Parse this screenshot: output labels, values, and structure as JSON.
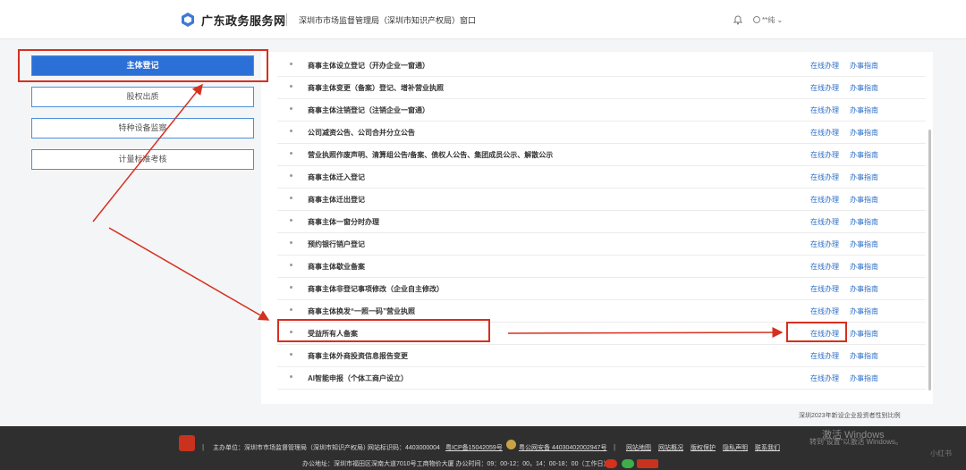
{
  "header": {
    "site_title": "广东政务服务网",
    "department": "深圳市市场监督管理局（深圳市知识产权局）窗口",
    "user_name": "**纯"
  },
  "left_nav": {
    "items": [
      {
        "label": "主体登记",
        "active": true
      },
      {
        "label": "股权出质",
        "active": false
      },
      {
        "label": "特种设备监察",
        "active": false
      },
      {
        "label": "计量标准考核",
        "active": false
      }
    ]
  },
  "service_list": {
    "online_label": "在线办理",
    "guide_label": "办事指南",
    "items": [
      "商事主体设立登记（开办企业一窗通）",
      "商事主体变更（备案）登记、增补营业执照",
      "商事主体注销登记（注销企业一窗通）",
      "公司减资公告、公司合并分立公告",
      "营业执照作废声明、清算组公告/备案、债权人公告、集团成员公示、解散公示",
      "商事主体迁入登记",
      "商事主体迁出登记",
      "商事主体一窗分时办理",
      "预约银行销户登记",
      "商事主体歇业备案",
      "商事主体非登记事项修改（企业自主修改）",
      "商事主体换发“一照一码”营业执照",
      "受益所有人备案",
      "商事主体外商投资信息报告变更",
      "AI智能申报（个体工商户设立）"
    ]
  },
  "caption": "深圳2023年新设企业投资者性别比例",
  "footer": {
    "sponsor": "主办单位：深圳市市场监督管理局（深圳市知识产权局）",
    "site_code": "网站标识码：4403000004",
    "icp": "粤ICP备15042059号",
    "police": "粤公网安备 44030402002947号",
    "links": [
      "网站地图",
      "网站概况",
      "版权保护",
      "隐私声明",
      "联系我们"
    ],
    "address": "办公地址：深圳市福田区深南大道7010号工商物价大厦  办公时间：09：00-12：00，14：00-18：00（工作日）"
  },
  "os_overlay": {
    "activate_title": "激活 Windows",
    "activate_hint": "转到“设置”以激活 Windows。",
    "watermark": "小红书"
  },
  "colors": {
    "accent_blue": "#2b70d6",
    "link_blue": "#2b6ec9",
    "highlight_red": "#d6301f",
    "footer_bg": "#2f2f2f"
  }
}
